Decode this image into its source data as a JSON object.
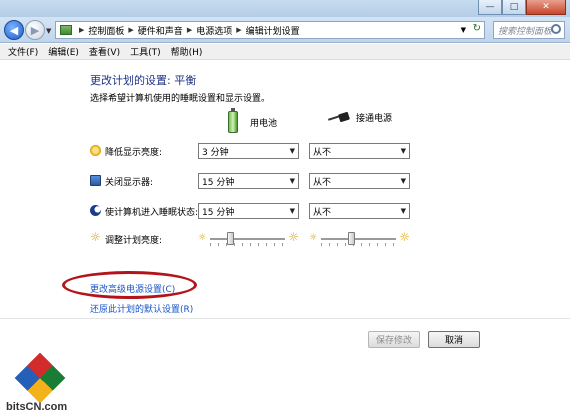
{
  "window": {
    "minimize_label": "—",
    "maximize_label": "□",
    "close_label": "✕"
  },
  "address": {
    "breadcrumbs": [
      "控制面板",
      "硬件和声音",
      "电源选项",
      "编辑计划设置"
    ],
    "search_placeholder": "搜索控制面板"
  },
  "menu": [
    "文件(F)",
    "编辑(E)",
    "查看(V)",
    "工具(T)",
    "帮助(H)"
  ],
  "page": {
    "title": "更改计划的设置: 平衡",
    "description": "选择希望计算机使用的睡眠设置和显示设置。",
    "column_battery": "用电池",
    "column_plugged": "接通电源"
  },
  "settings": [
    {
      "label": "降低显示亮度:",
      "icon": "dim-display-icon",
      "battery": "3 分钟",
      "plugged": "从不"
    },
    {
      "label": "关闭显示器:",
      "icon": "monitor-icon",
      "battery": "15 分钟",
      "plugged": "从不"
    },
    {
      "label": "使计算机进入睡眠状态:",
      "icon": "sleep-icon",
      "battery": "15 分钟",
      "plugged": "从不"
    }
  ],
  "brightness": {
    "label": "调整计划亮度:",
    "battery_level": 0.25,
    "plugged_level": 0.4
  },
  "links": {
    "advanced": "更改高级电源设置(C)",
    "restore": "还原此计划的默认设置(R)"
  },
  "buttons": {
    "save": "保存修改",
    "cancel": "取消"
  },
  "watermark": {
    "text": "bitsCN.com"
  },
  "colors": {
    "title": "#1e3287",
    "link": "#1a55c8",
    "highlight": "#b3141a"
  }
}
